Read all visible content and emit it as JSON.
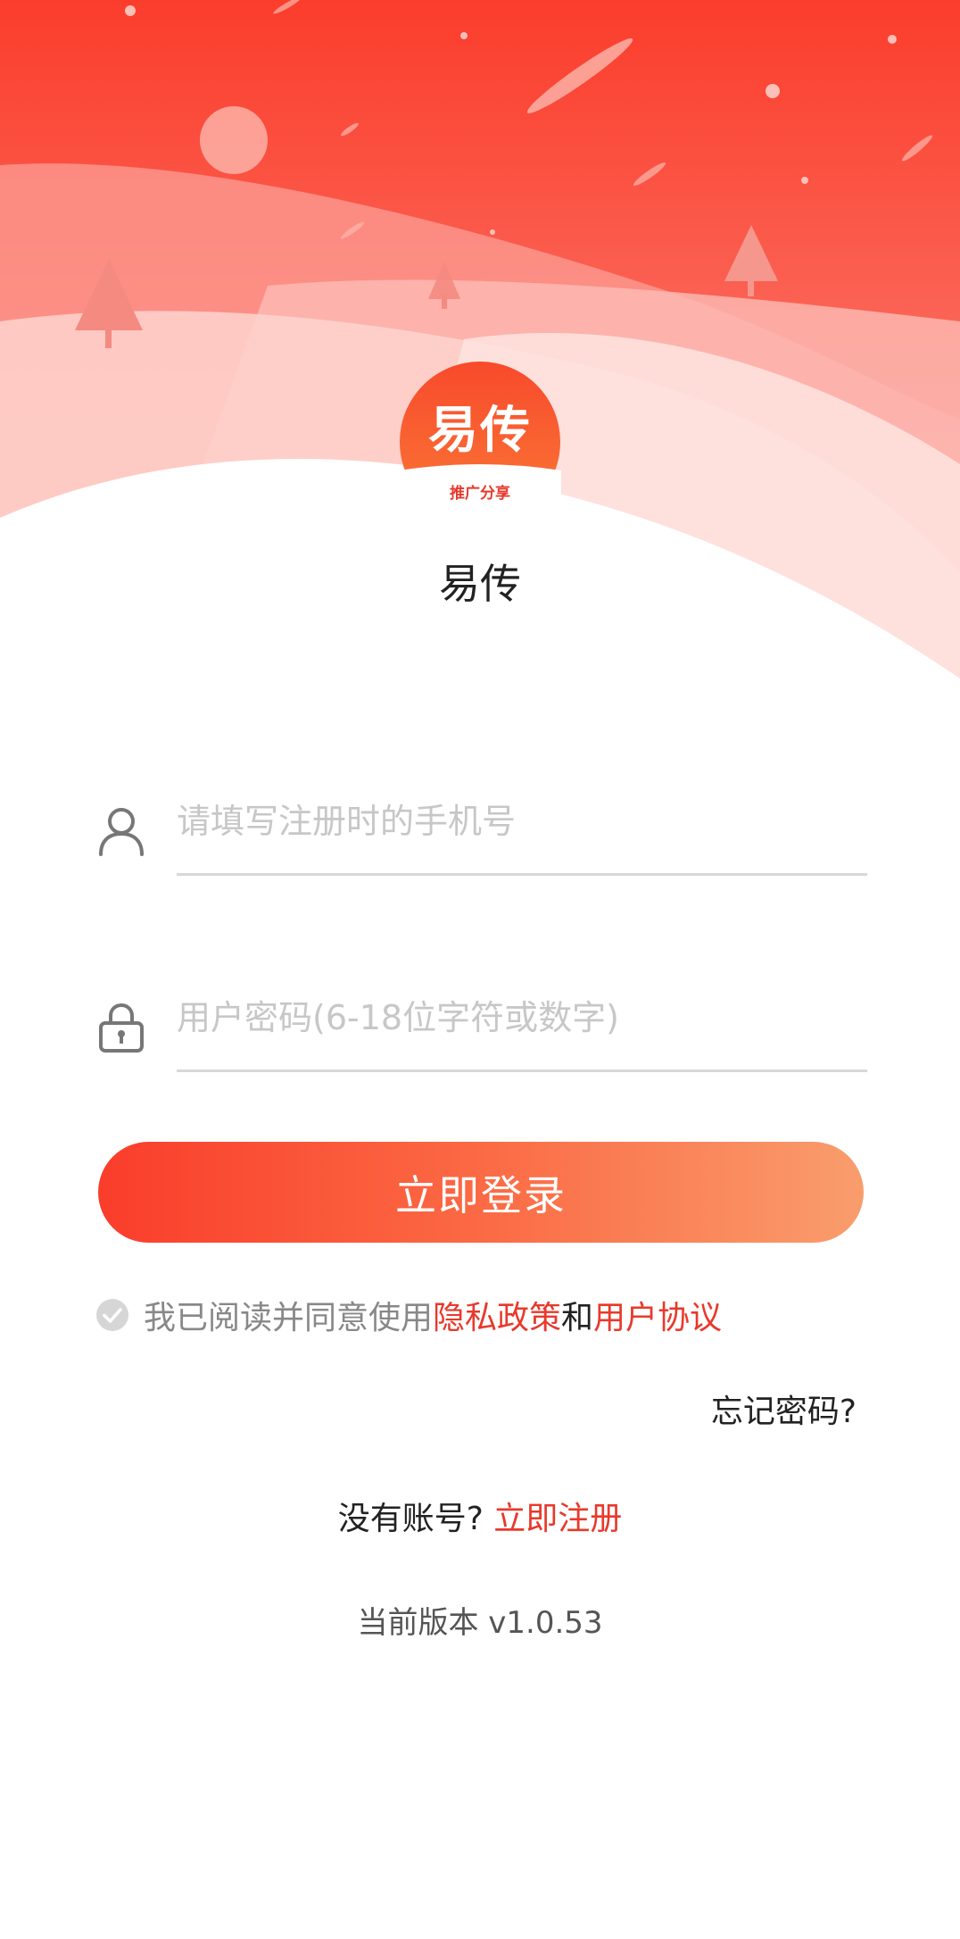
{
  "logo": {
    "main_text": "易传",
    "sub_text": "推广分享"
  },
  "app_name": "易传",
  "form": {
    "phone_placeholder": "请填写注册时的手机号",
    "password_placeholder": "用户密码(6-18位字符或数字)",
    "login_label": "立即登录"
  },
  "agreement": {
    "prefix": "我已阅读并同意使用",
    "privacy_link": "隐私政策",
    "conjunction": "和",
    "terms_link": "用户协议",
    "checked": true
  },
  "forgot_password": "忘记密码?",
  "register": {
    "question": "没有账号?",
    "link": "立即注册"
  },
  "version": "当前版本 v1.0.53",
  "colors": {
    "accent": "#e8392b",
    "button_start": "#fa3d2b",
    "button_end": "#f99d6d",
    "hero_top": "#fb3d2c"
  },
  "icons": {
    "phone_field": "user-icon",
    "password_field": "lock-icon",
    "agreement": "check-circle-icon"
  }
}
